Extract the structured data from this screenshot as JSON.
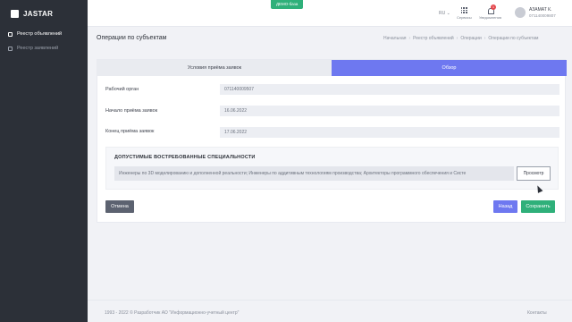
{
  "app": {
    "brand": "JASTAR",
    "demo_badge": "ДЕМО-база"
  },
  "sidebar": {
    "items": [
      {
        "label": "Реестр объявлений",
        "active": true
      },
      {
        "label": "Реестр заявлений",
        "active": false
      }
    ]
  },
  "topbar": {
    "language": "RU ⌄",
    "services_label": "Сервисы",
    "notifications_label": "Уведомления",
    "notifications_count": "1",
    "user_name": "АЗАМАТ К.",
    "user_id": "071140009807"
  },
  "page": {
    "title": "Операции по субъектам",
    "breadcrumb": [
      "Начальная",
      "Реестр объявлений",
      "Операции",
      "Операции по субъектам"
    ]
  },
  "tabs": {
    "conditions": "Условия приёма заявок",
    "overview": "Обзор"
  },
  "form": {
    "rows": [
      {
        "label": "Рабочий орган",
        "value": "071140009507"
      },
      {
        "label": "Начало приёма заявок",
        "value": "16.06.2022"
      },
      {
        "label": "Конец приёма заявок",
        "value": "17.06.2022"
      }
    ],
    "specs_title": "ДОПУСТИМЫЕ ВОСТРЕБОВАННЫЕ СПЕЦИАЛЬНОСТИ",
    "specs_value": "Инженеры по 3D моделированию и дополненной реальности; Инженеры по аддитивным технологиям производства; Архитекторы программного обеспечения и Систе",
    "view_button": "Просмотр"
  },
  "buttons": {
    "cancel": "Отмена",
    "back": "Назад",
    "save": "Сохранить"
  },
  "footer": {
    "copyright": "1993 - 2022 © Разработчик АО \"Информационно-учетный центр\"",
    "contacts": "Контакты"
  }
}
